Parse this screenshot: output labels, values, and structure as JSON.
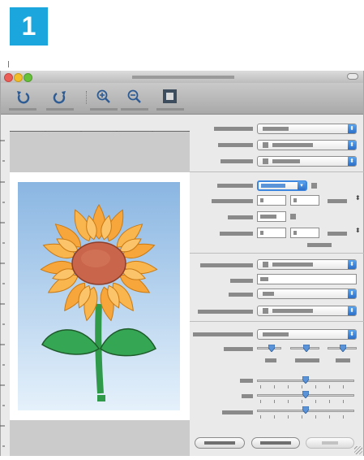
{
  "step": {
    "number": "1",
    "color": "#1ba7de"
  },
  "window": {
    "traffic_lights": [
      "close-icon",
      "minimize-icon",
      "zoom-icon"
    ],
    "toolbar": {
      "buttons": [
        "rotate-left-icon",
        "rotate-right-icon",
        "zoom-in-icon",
        "zoom-out-icon",
        "stop-icon"
      ],
      "icon_color": "#2d5b94"
    },
    "preview": {
      "image": "sunflower",
      "sky_color": "#8ab6e2",
      "petal_color": "#f7a63c",
      "center_color": "#c9654a",
      "stem_color": "#2e9a4a"
    },
    "settings": {
      "popups": 9,
      "fields": 6,
      "sliders": 6,
      "accent": "#3d86df"
    },
    "buttons": [
      "button-1",
      "button-2",
      "button-3-disabled"
    ]
  }
}
